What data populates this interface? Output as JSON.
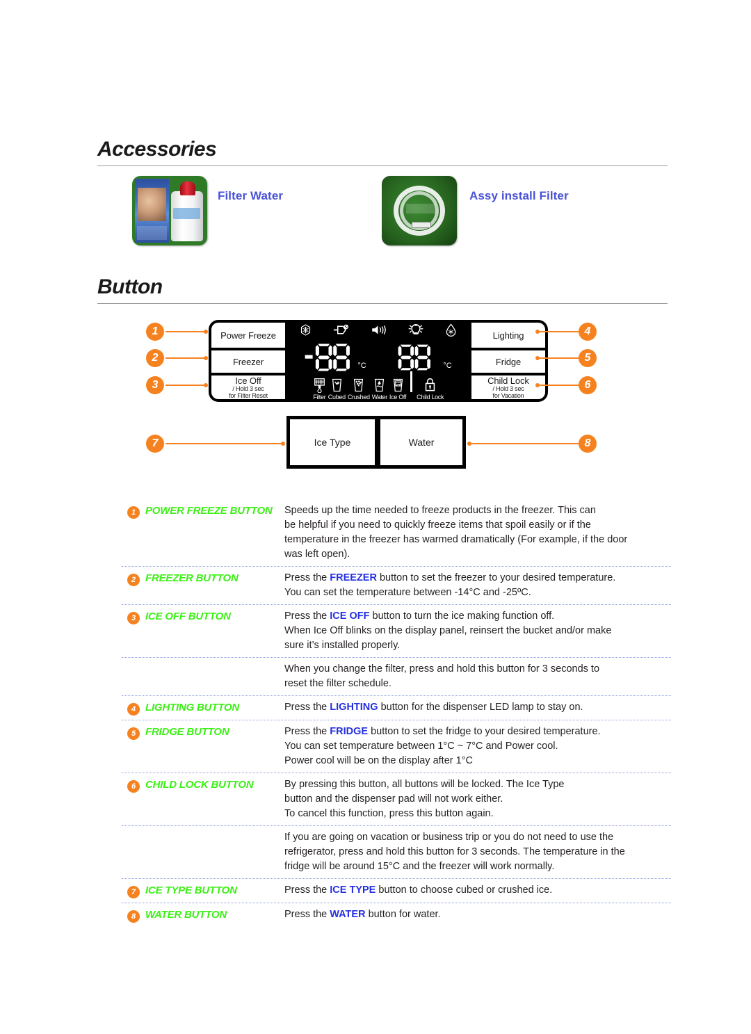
{
  "sections": {
    "accessories": {
      "title": "Accessories",
      "items": [
        {
          "label": "Filter Water",
          "image": "water-filter-cartridge-photo"
        },
        {
          "label": "Assy install Filter",
          "image": "filter-install-tubing-photo"
        }
      ]
    },
    "button": {
      "title": "Button"
    }
  },
  "colors": {
    "badge_orange": "#f5821f",
    "name_green": "#3bf014",
    "highlight_blue": "#2430e0",
    "link_blue": "#4a53d6",
    "separator_blue": "#8f9bdd"
  },
  "panel": {
    "left_buttons": [
      {
        "number": "1",
        "title": "Power Freeze",
        "sub": ""
      },
      {
        "number": "2",
        "title": "Freezer",
        "sub": ""
      },
      {
        "number": "3",
        "title": "Ice Off",
        "sub": "/ Hold 3 sec\nfor Filter Reset"
      }
    ],
    "right_buttons": [
      {
        "number": "4",
        "title": "Lighting",
        "sub": ""
      },
      {
        "number": "5",
        "title": "Fridge",
        "sub": ""
      },
      {
        "number": "6",
        "title": "Child Lock",
        "sub": "/ Hold 3 sec\nfor Vacation"
      }
    ],
    "pads": [
      {
        "number": "7",
        "label": "Ice Type"
      },
      {
        "number": "8",
        "label": "Water"
      }
    ],
    "lcd": {
      "top_icons": [
        "power-freeze-snowflake-icon",
        "vacation-plug-icon",
        "alarm-speaker-icon",
        "lighting-bulb-icon",
        "power-cool-drop-icon"
      ],
      "freezer_value": "-88",
      "freezer_unit": "°C",
      "fridge_value": "88",
      "fridge_unit": "°C",
      "bottom_icons": [
        {
          "icon": "filter-icon",
          "caption": "Filter"
        },
        {
          "icon": "cubed-ice-icon",
          "caption": "Cubed"
        },
        {
          "icon": "crushed-ice-icon",
          "caption": "Crushed"
        },
        {
          "icon": "water-icon",
          "caption": "Water"
        },
        {
          "icon": "ice-off-icon",
          "caption": "Ice Off"
        },
        {
          "icon": "child-lock-icon",
          "caption": "Child Lock"
        }
      ]
    }
  },
  "descriptions": [
    {
      "number": "1",
      "name": "POWER FREEZE BUTTON",
      "lines": [
        "Speeds up the time needed to freeze products in the freezer. This can",
        "be helpful if you need to quickly freeze items that spoil easily or if the",
        "temperature in the freezer has warmed dramatically (For example, if the door",
        "was left open)."
      ]
    },
    {
      "number": "2",
      "name": "FREEZER BUTTON",
      "lines": [
        "Press the |FREEZER| button to set the freezer to your desired temperature.",
        "You can set the temperature between -14°C and -25ºC."
      ]
    },
    {
      "number": "3",
      "name": "ICE OFF BUTTON",
      "lines": [
        "Press the |ICE OFF| button to turn the ice making function off.",
        "When Ice Off blinks on the display panel, reinsert the bucket and/or make",
        "sure it’s installed properly."
      ]
    },
    {
      "number": "",
      "name": "",
      "lines": [
        "When you change the filter, press and hold this button for 3 seconds to",
        "reset the filter schedule."
      ]
    },
    {
      "number": "4",
      "name": "LIGHTING BUTTON",
      "lines": [
        "Press the |LIGHTING| button for the dispenser LED lamp to stay on."
      ]
    },
    {
      "number": "5",
      "name": "FRIDGE BUTTON",
      "lines": [
        "Press the |FRIDGE| button to set the fridge to your desired temperature.",
        "You can set temperature between 1°C ~ 7°C and Power cool.",
        "Power cool will be on the display after 1°C"
      ]
    },
    {
      "number": "6",
      "name": "CHILD LOCK BUTTON",
      "lines": [
        "By pressing this button, all buttons will be locked. The Ice Type",
        "button and the dispenser pad will not work either.",
        "To cancel this function, press this button again."
      ]
    },
    {
      "number": "",
      "name": "",
      "lines": [
        "If you are going on vacation or business trip or you do not need to use the",
        "refrigerator, press and hold this button for 3 seconds. The temperature in the",
        "fridge will be around 15°C and the freezer will work normally."
      ]
    },
    {
      "number": "7",
      "name": "ICE TYPE BUTTON",
      "lines": [
        "Press the |ICE TYPE| button to choose cubed or crushed ice."
      ]
    },
    {
      "number": "8",
      "name": "WATER BUTTON",
      "lines": [
        "Press the |WATER| button for water."
      ]
    }
  ]
}
